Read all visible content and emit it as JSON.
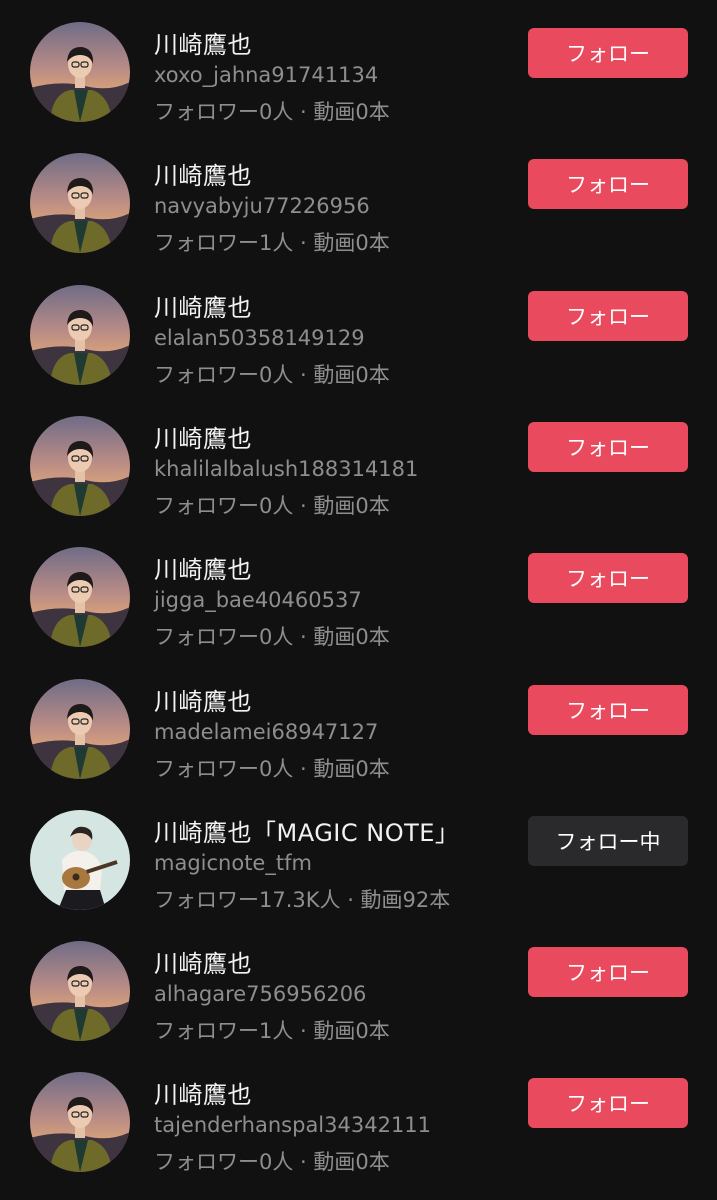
{
  "colors": {
    "background": "#111111",
    "follow_button": "#ea4a5d",
    "following_button": "#2a2a2c",
    "name_text": "#f2f2f2",
    "meta_text": "#8e8e8e"
  },
  "users": [
    {
      "name": "川崎鷹也",
      "handle": "xoxo_jahna91741134",
      "stats": "フォロワー0人 · 動画0本",
      "button": "フォロー",
      "state": "follow",
      "avatar": "portrait-sunset-icon"
    },
    {
      "name": "川崎鷹也",
      "handle": "navyabyju77226956",
      "stats": "フォロワー1人 · 動画0本",
      "button": "フォロー",
      "state": "follow",
      "avatar": "portrait-sunset-icon"
    },
    {
      "name": "川崎鷹也",
      "handle": "elalan50358149129",
      "stats": "フォロワー0人 · 動画0本",
      "button": "フォロー",
      "state": "follow",
      "avatar": "portrait-sunset-icon"
    },
    {
      "name": "川崎鷹也",
      "handle": "khalilalbalush188314181",
      "stats": "フォロワー0人 · 動画0本",
      "button": "フォロー",
      "state": "follow",
      "avatar": "portrait-sunset-icon"
    },
    {
      "name": "川崎鷹也",
      "handle": "jigga_bae40460537",
      "stats": "フォロワー0人 · 動画0本",
      "button": "フォロー",
      "state": "follow",
      "avatar": "portrait-sunset-icon"
    },
    {
      "name": "川崎鷹也",
      "handle": "madelamei68947127",
      "stats": "フォロワー0人 · 動画0本",
      "button": "フォロー",
      "state": "follow",
      "avatar": "portrait-sunset-icon"
    },
    {
      "name": "川崎鷹也「MAGIC NOTE」",
      "handle": "magicnote_tfm",
      "stats": "フォロワー17.3K人 · 動画92本",
      "button": "フォロー中",
      "state": "following",
      "avatar": "guitar-player-icon"
    },
    {
      "name": "川崎鷹也",
      "handle": "alhagare756956206",
      "stats": "フォロワー1人 · 動画0本",
      "button": "フォロー",
      "state": "follow",
      "avatar": "portrait-sunset-icon"
    },
    {
      "name": "川崎鷹也",
      "handle": "tajenderhanspal34342111",
      "stats": "フォロワー0人 · 動画0本",
      "button": "フォロー",
      "state": "follow",
      "avatar": "portrait-sunset-icon"
    }
  ]
}
